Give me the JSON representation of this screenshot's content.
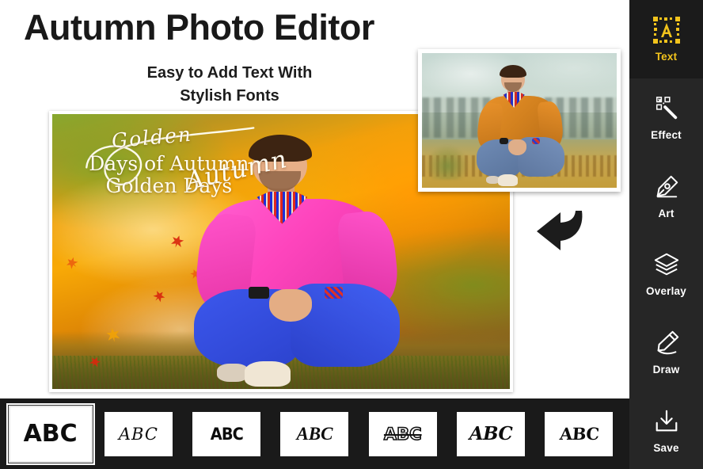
{
  "promo": {
    "title": "Autumn Photo Editor",
    "subtitle_line1": "Easy to Add Text With",
    "subtitle_line2": "Stylish Fonts"
  },
  "canvas": {
    "main_photo_alt": "Edited autumn photo of a man in a pink sweater and blue jeans sitting cross-legged on grass with an autumn foliage background",
    "inset_photo_alt": "Original photo of a man in an orange sweater and blue jeans sitting cross-legged with a blurred city park background",
    "arrow_label": "curved-left-arrow",
    "text_overlays": [
      {
        "id": "script_golden",
        "text": "Golden",
        "style": "script"
      },
      {
        "id": "block_text",
        "text": "Days of Autumn Golden Days",
        "style": "serif-block"
      },
      {
        "id": "script_autumn",
        "text": "Autumn",
        "style": "script"
      }
    ]
  },
  "sidebar": {
    "items": [
      {
        "label": "Text",
        "icon": "text-frame-icon",
        "active": true
      },
      {
        "label": "Effect",
        "icon": "magic-wand-icon",
        "active": false
      },
      {
        "label": "Art",
        "icon": "pen-nib-icon",
        "active": false
      },
      {
        "label": "Overlay",
        "icon": "layers-icon",
        "active": false
      },
      {
        "label": "Draw",
        "icon": "pencil-icon",
        "active": false
      },
      {
        "label": "Save",
        "icon": "download-icon",
        "active": false
      }
    ],
    "active_color": "#f2c31c",
    "background": "#262626"
  },
  "font_strip": {
    "background": "#1a1a1a",
    "selected_index": 0,
    "tiles": [
      {
        "label": "ABC",
        "style": "bold-display",
        "selected": true
      },
      {
        "label": "ABC",
        "style": "italic-serif",
        "selected": false
      },
      {
        "label": "ABC",
        "style": "condensed-bold",
        "selected": false
      },
      {
        "label": "ABC",
        "style": "bold-italic-serif",
        "selected": false
      },
      {
        "label": "ABC",
        "style": "outline-strike",
        "selected": false
      },
      {
        "label": "ABC",
        "style": "script-bold",
        "selected": false
      },
      {
        "label": "ABC",
        "style": "slab-bold",
        "selected": false
      }
    ]
  }
}
